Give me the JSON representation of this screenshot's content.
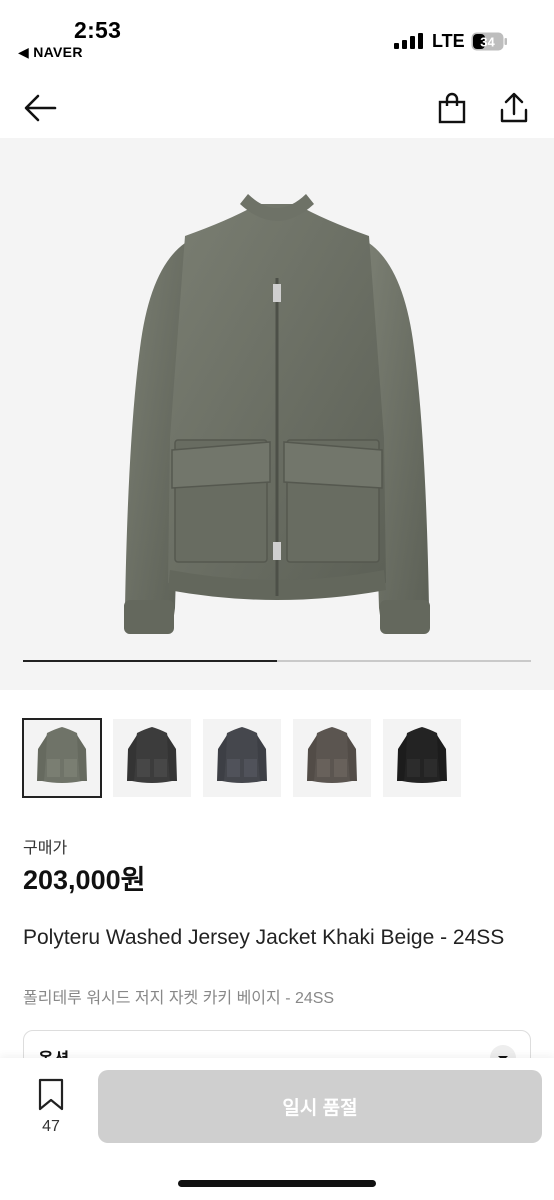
{
  "status_bar": {
    "time": "2:53",
    "back_app": "◀ NAVER",
    "network": "LTE",
    "battery": "34"
  },
  "nav": {
    "back_icon": "arrow-left-icon",
    "bag_icon": "shopping-bag-icon",
    "share_icon": "share-icon"
  },
  "gallery": {
    "progress": 0.5,
    "thumbnails": [
      {
        "color": "khaki",
        "hex": "#6f7368"
      },
      {
        "color": "charcoal",
        "hex": "#3c3c3c"
      },
      {
        "color": "navy-grey",
        "hex": "#45474d"
      },
      {
        "color": "brown-grey",
        "hex": "#5b5550"
      },
      {
        "color": "black",
        "hex": "#232323"
      }
    ]
  },
  "product": {
    "price_label": "구매가",
    "price": "203,000원",
    "title_en": "Polyteru Washed Jersey Jacket Khaki Beige - 24SS",
    "title_ko": "폴리테루 워시드 저지 자켓 카키 베이지 - 24SS"
  },
  "option": {
    "label": "옵션"
  },
  "bottom_bar": {
    "bookmark_count": "47",
    "soldout_label": "일시 품절"
  }
}
